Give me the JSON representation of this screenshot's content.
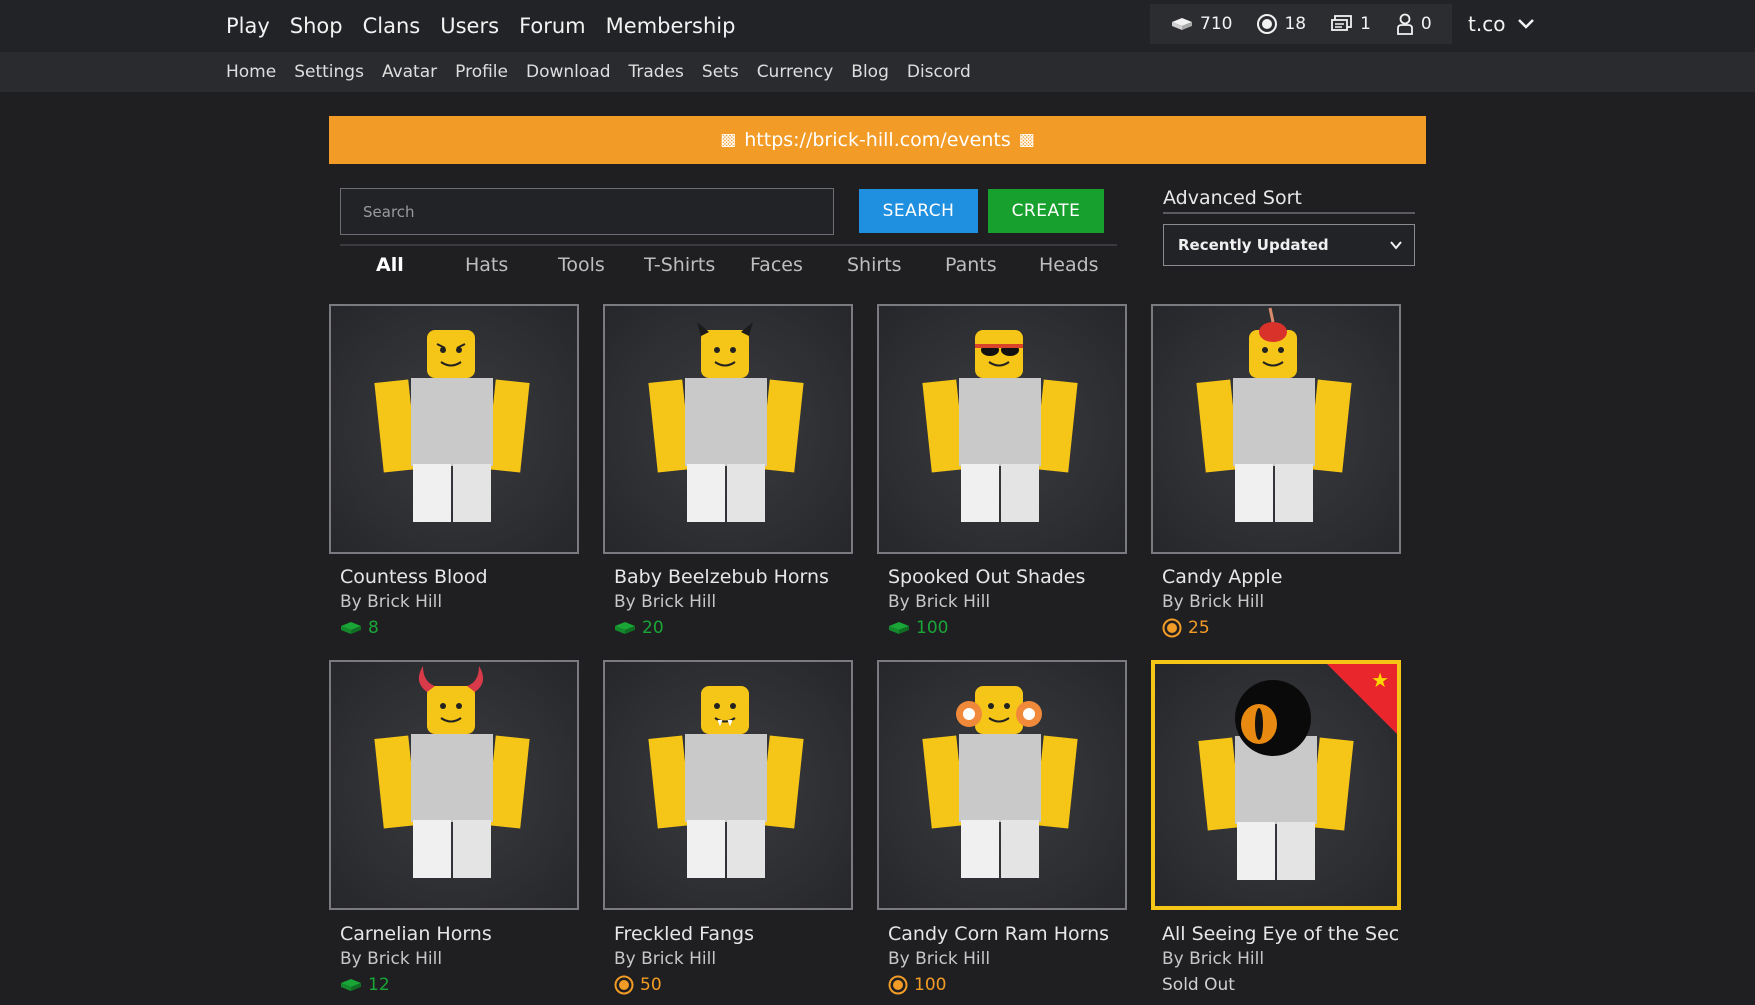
{
  "topnav": {
    "items": [
      "Play",
      "Shop",
      "Clans",
      "Users",
      "Forum",
      "Membership"
    ]
  },
  "stats": {
    "bits": "710",
    "bucks": "18",
    "messages": "1",
    "friend_requests": "0"
  },
  "user": {
    "name": "t.co"
  },
  "subnav": {
    "items": [
      "Home",
      "Settings",
      "Avatar",
      "Profile",
      "Download",
      "Trades",
      "Sets",
      "Currency",
      "Blog",
      "Discord"
    ]
  },
  "banner": {
    "text": "https://brick-hill.com/events"
  },
  "search": {
    "placeholder": "Search",
    "button": "SEARCH",
    "create": "CREATE"
  },
  "tabs": [
    "All",
    "Hats",
    "Tools",
    "T-Shirts",
    "Faces",
    "Shirts",
    "Pants",
    "Heads"
  ],
  "sort": {
    "label": "Advanced Sort",
    "selected": "Recently Updated"
  },
  "colors": {
    "bits": "#1aa637",
    "bucks": "#f29b26",
    "search": "#1f8fe0",
    "create": "#17a02e",
    "banner": "#f29b26",
    "featured": "#f5c518"
  },
  "items": [
    {
      "name": "Countess Blood",
      "creator": "By Brick Hill",
      "price": "8",
      "currency": "bits"
    },
    {
      "name": "Baby Beelzebub Horns",
      "creator": "By Brick Hill",
      "price": "20",
      "currency": "bits"
    },
    {
      "name": "Spooked Out Shades",
      "creator": "By Brick Hill",
      "price": "100",
      "currency": "bits"
    },
    {
      "name": "Candy Apple",
      "creator": "By Brick Hill",
      "price": "25",
      "currency": "bucks"
    },
    {
      "name": "Carnelian Horns",
      "creator": "By Brick Hill",
      "price": "12",
      "currency": "bits"
    },
    {
      "name": "Freckled Fangs",
      "creator": "By Brick Hill",
      "price": "50",
      "currency": "bucks"
    },
    {
      "name": "Candy Corn Ram Horns",
      "creator": "By Brick Hill",
      "price": "100",
      "currency": "bucks"
    },
    {
      "name": "All Seeing Eye of the Sec",
      "creator": "By Brick Hill",
      "price": "Sold Out",
      "currency": "none"
    }
  ]
}
